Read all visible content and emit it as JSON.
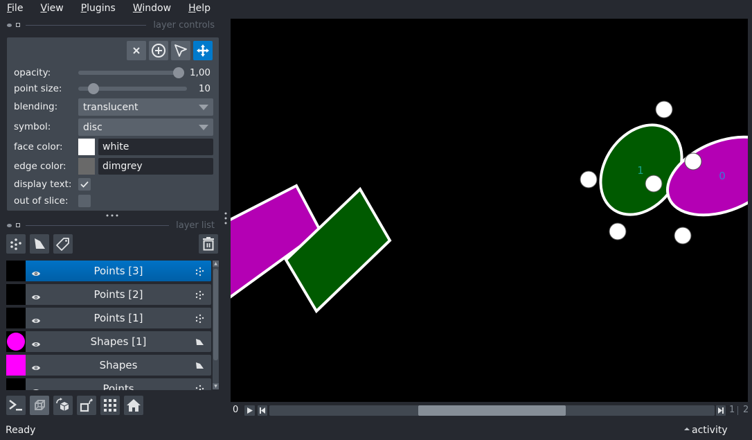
{
  "menubar": {
    "items": [
      {
        "label": "File",
        "mnemonic": "F",
        "rest": "ile"
      },
      {
        "label": "View",
        "mnemonic": "V",
        "rest": "iew"
      },
      {
        "label": "Plugins",
        "mnemonic": "P",
        "rest": "lugins"
      },
      {
        "label": "Window",
        "mnemonic": "W",
        "rest": "indow"
      },
      {
        "label": "Help",
        "mnemonic": "H",
        "rest": "elp"
      }
    ]
  },
  "layer_controls": {
    "title": "layer controls",
    "mode_buttons": [
      {
        "name": "delete-selected-points",
        "icon": "close-icon"
      },
      {
        "name": "add-points",
        "icon": "add-circle-icon"
      },
      {
        "name": "select-points",
        "icon": "arrow-select-icon"
      },
      {
        "name": "pan-zoom",
        "icon": "move-arrows-icon",
        "active": true
      }
    ],
    "opacity": {
      "label": "opacity:",
      "value": 1.0,
      "display": "1,00"
    },
    "point_size": {
      "label": "point size:",
      "value": 10,
      "display": "10",
      "min": 1,
      "max": 100
    },
    "blending": {
      "label": "blending:",
      "value": "translucent"
    },
    "symbol": {
      "label": "symbol:",
      "value": "disc"
    },
    "face_color": {
      "label": "face color:",
      "value": "white",
      "swatch": "#ffffff"
    },
    "edge_color": {
      "label": "edge color:",
      "value": "dimgrey",
      "swatch": "#696969"
    },
    "display_text": {
      "label": "display text:",
      "checked": true
    },
    "out_of_slice": {
      "label": "out of slice:",
      "checked": false
    }
  },
  "layer_list": {
    "title": "layer list",
    "buttons": [
      {
        "name": "new-points-layer",
        "icon": "points-icon"
      },
      {
        "name": "new-shapes-layer",
        "icon": "shapes-icon"
      },
      {
        "name": "new-labels-layer",
        "icon": "label-tag-icon"
      }
    ],
    "delete_button": {
      "icon": "trash-icon"
    },
    "layers": [
      {
        "name": "Points [3]",
        "type": "points",
        "visible": true,
        "selected": true,
        "thumb": "black"
      },
      {
        "name": "Points [2]",
        "type": "points",
        "visible": true,
        "selected": false,
        "thumb": "black"
      },
      {
        "name": "Points [1]",
        "type": "points",
        "visible": true,
        "selected": false,
        "thumb": "black"
      },
      {
        "name": "Shapes [1]",
        "type": "shapes",
        "visible": true,
        "selected": false,
        "thumb": "magenta-circle"
      },
      {
        "name": "Shapes",
        "type": "shapes",
        "visible": true,
        "selected": false,
        "thumb": "magenta-square"
      },
      {
        "name": "Points",
        "type": "points",
        "visible": true,
        "selected": false,
        "thumb": "black"
      }
    ]
  },
  "viewer_buttons": [
    {
      "name": "console-button",
      "icon": "console-icon"
    },
    {
      "name": "ndisplay-button",
      "icon": "cube-3d-icon",
      "active": true
    },
    {
      "name": "roll-dims-button",
      "icon": "rotate-cube-icon"
    },
    {
      "name": "transpose-dims-button",
      "icon": "transpose-icon"
    },
    {
      "name": "grid-view-button",
      "icon": "grid-icon"
    },
    {
      "name": "reset-view-button",
      "icon": "home-icon"
    }
  ],
  "canvas": {
    "shapes": [
      {
        "kind": "rectangle",
        "color": "#b400b4",
        "label": ""
      },
      {
        "kind": "rectangle",
        "color": "#005a00",
        "label": ""
      },
      {
        "kind": "ellipse",
        "color": "#005a00",
        "label": "1",
        "text_color": "#1aa38a"
      },
      {
        "kind": "ellipse",
        "color": "#b400b4",
        "label": "0",
        "text_color": "#3a7ad8"
      }
    ],
    "points_color": "#ffffff"
  },
  "dims": {
    "current": "0",
    "position": "1",
    "total": "2",
    "slider_fraction": 0.0
  },
  "status": {
    "message": "Ready",
    "activity_label": "activity"
  },
  "colors": {
    "accent": "#007acc",
    "background": "#262930",
    "panel": "#414851",
    "control": "#5a626c"
  }
}
